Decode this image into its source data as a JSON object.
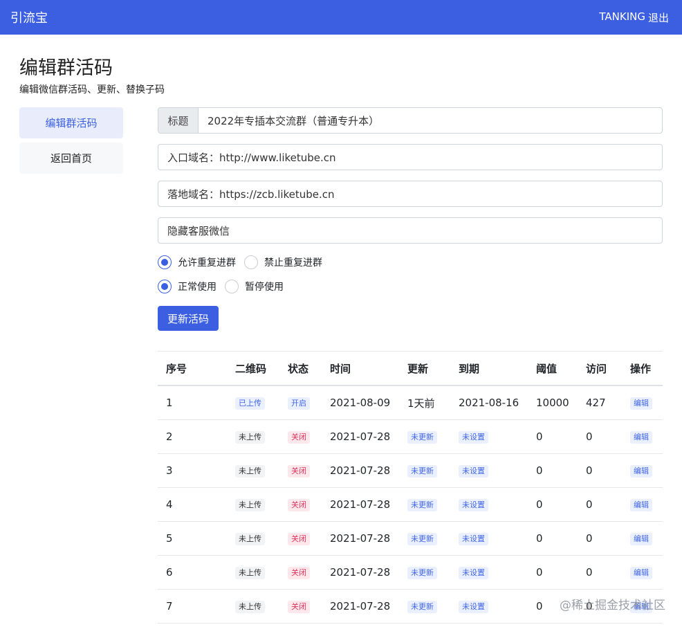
{
  "topbar": {
    "brand": "引流宝",
    "user": "TANKING",
    "logout": "退出"
  },
  "page": {
    "title": "编辑群活码",
    "subtitle": "编辑微信群活码、更新、替换子码"
  },
  "sidebar": {
    "items": [
      {
        "label": "编辑群活码"
      },
      {
        "label": "返回首页"
      }
    ]
  },
  "form": {
    "title_addon": "标题",
    "title_value": "2022年专插本交流群（普通专升本）",
    "entry_domain": "入口域名：http://www.liketube.cn",
    "landing_domain": "落地域名：https://zcb.liketube.cn",
    "hidden_service": "隐藏客服微信",
    "radio_group1": [
      "允许重复进群",
      "禁止重复进群"
    ],
    "radio_group2": [
      "正常使用",
      "暂停使用"
    ],
    "submit": "更新活码"
  },
  "table": {
    "headers": [
      "序号",
      "二维码",
      "状态",
      "时间",
      "更新",
      "到期",
      "阈值",
      "访问",
      "操作"
    ],
    "rows": [
      [
        "1",
        "已上传",
        "开启",
        "2021-08-09",
        "1天前",
        "2021-08-16",
        "10000",
        "427",
        "编辑"
      ],
      [
        "2",
        "未上传",
        "关闭",
        "2021-07-28",
        "未更新",
        "未设置",
        "0",
        "0",
        "编辑"
      ],
      [
        "3",
        "未上传",
        "关闭",
        "2021-07-28",
        "未更新",
        "未设置",
        "0",
        "0",
        "编辑"
      ],
      [
        "4",
        "未上传",
        "关闭",
        "2021-07-28",
        "未更新",
        "未设置",
        "0",
        "0",
        "编辑"
      ],
      [
        "5",
        "未上传",
        "关闭",
        "2021-07-28",
        "未更新",
        "未设置",
        "0",
        "0",
        "编辑"
      ],
      [
        "6",
        "未上传",
        "关闭",
        "2021-07-28",
        "未更新",
        "未设置",
        "0",
        "0",
        "编辑"
      ],
      [
        "7",
        "未上传",
        "关闭",
        "2021-07-28",
        "未更新",
        "未设置",
        "0",
        "0",
        "编辑"
      ]
    ]
  },
  "watermark": "@稀土掘金技术社区",
  "colors": {
    "primary": "#3b5fe0",
    "danger": "#e0315a"
  }
}
